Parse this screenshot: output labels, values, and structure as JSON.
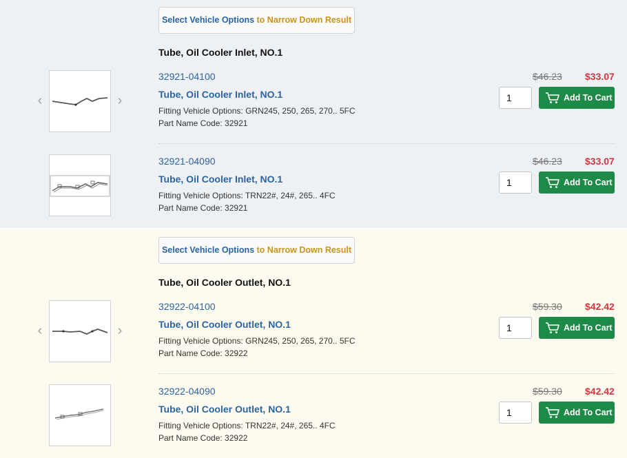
{
  "narrow": {
    "part1": "Select Vehicle Options",
    "part2": " to Narrow Down Result"
  },
  "groups": [
    {
      "title": "Tube, Oil Cooler Inlet, NO.1",
      "items": [
        {
          "part_no": "32921-04100",
          "name": "Tube, Oil Cooler Inlet, NO.1",
          "fitting": "Fitting Vehicle Options: GRN245, 250, 265, 270.. 5FC",
          "name_code": "Part Name Code: 32921",
          "old_price": "$46.23",
          "new_price": "$33.07",
          "qty": "1",
          "cart_label": "Add To Cart"
        },
        {
          "part_no": "32921-04090",
          "name": "Tube, Oil Cooler Inlet, NO.1",
          "fitting": "Fitting Vehicle Options: TRN22#, 24#, 265.. 4FC",
          "name_code": "Part Name Code: 32921",
          "old_price": "$46.23",
          "new_price": "$33.07",
          "qty": "1",
          "cart_label": "Add To Cart"
        }
      ]
    },
    {
      "title": "Tube, Oil Cooler Outlet, NO.1",
      "items": [
        {
          "part_no": "32922-04100",
          "name": "Tube, Oil Cooler Outlet, NO.1",
          "fitting": "Fitting Vehicle Options: GRN245, 250, 265, 270.. 5FC",
          "name_code": "Part Name Code: 32922",
          "old_price": "$59.30",
          "new_price": "$42.42",
          "qty": "1",
          "cart_label": "Add To Cart"
        },
        {
          "part_no": "32922-04090",
          "name": "Tube, Oil Cooler Outlet, NO.1",
          "fitting": "Fitting Vehicle Options: TRN22#, 24#, 265.. 4FC",
          "name_code": "Part Name Code: 32922",
          "old_price": "$59.30",
          "new_price": "$42.42",
          "qty": "1",
          "cart_label": "Add To Cart"
        }
      ]
    }
  ],
  "icons": {
    "prev": "chevron-left-icon",
    "next": "chevron-right-icon",
    "cart": "cart-icon"
  },
  "colors": {
    "link": "#2a64a3",
    "accent": "#c9941a",
    "sale": "#d9333f",
    "cart_button": "#1e8a47"
  }
}
